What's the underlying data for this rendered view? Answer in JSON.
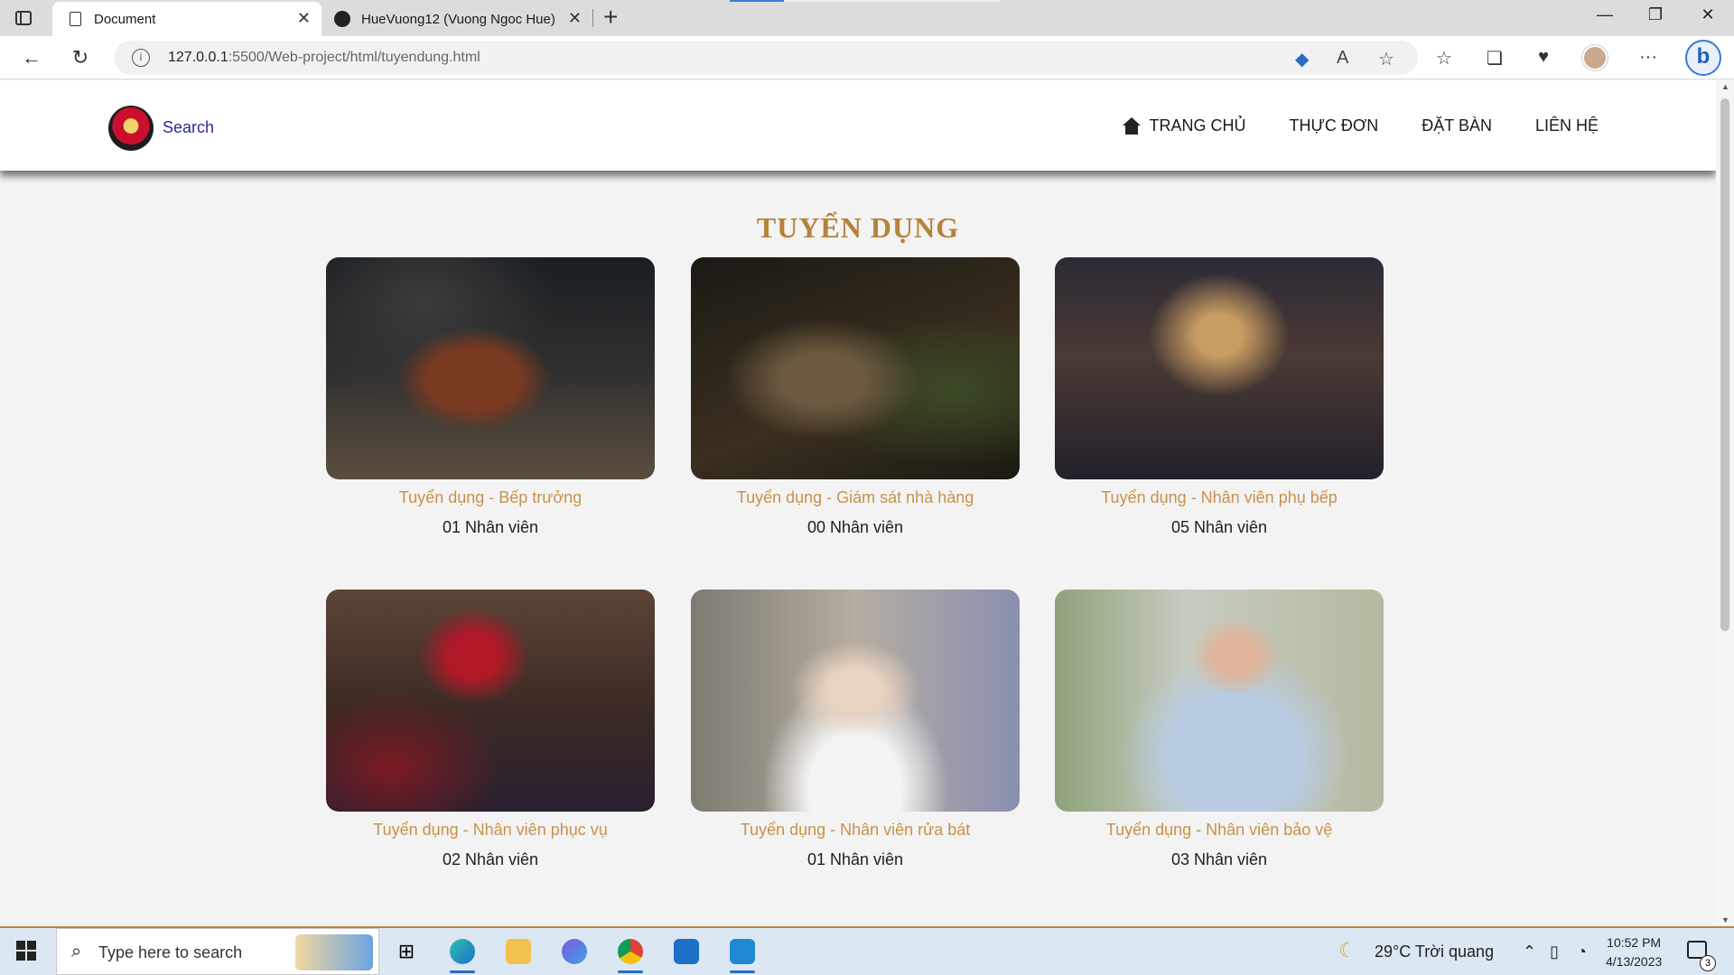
{
  "browser": {
    "tabs": [
      {
        "title": "Document",
        "active": true
      },
      {
        "title": "HueVuong12 (Vuong Ngoc Hue)",
        "active": false
      }
    ],
    "url_host": "127.0.0.1",
    "url_path": ":5500/Web-project/html/tuyendung.html"
  },
  "site": {
    "search_label": "Search",
    "menu": [
      "TRANG CHỦ",
      "THỰC ĐƠN",
      "ĐẶT BÀN",
      "LIÊN HỆ"
    ]
  },
  "page": {
    "title": "TUYỂN DỤNG",
    "jobs": [
      {
        "role": "Tuyển dụng - Bếp trưởng",
        "count": "01 Nhân viên"
      },
      {
        "role": "Tuyển dụng - Giám sát nhà hàng",
        "count": "00 Nhân viên"
      },
      {
        "role": "Tuyển dụng - Nhân viên phụ bếp",
        "count": "05 Nhân viên"
      },
      {
        "role": "Tuyển dụng - Nhân viên phục vụ",
        "count": "02 Nhân viên"
      },
      {
        "role": "Tuyển dụng - Nhân viên rửa bát",
        "count": "01 Nhân viên"
      },
      {
        "role": "Tuyển dụng - Nhân viên bảo vệ",
        "count": "03 Nhân viên"
      }
    ]
  },
  "taskbar": {
    "search_placeholder": "Type here to search",
    "weather": "29°C  Trời quang",
    "time": "10:52 PM",
    "date": "4/13/2023",
    "notifications": "3"
  },
  "colors": {
    "accent_gold": "#b6813a",
    "role_text": "#c8914a"
  }
}
